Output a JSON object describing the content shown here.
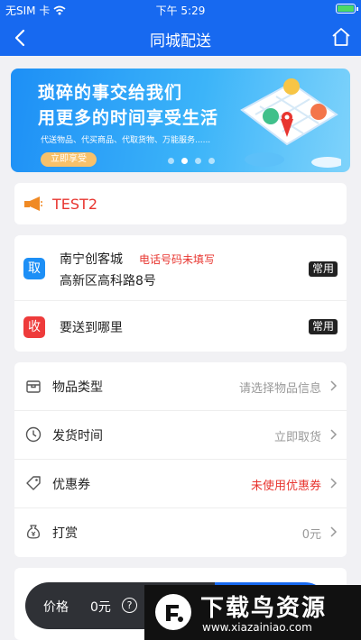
{
  "statusbar": {
    "carrier": "无SIM 卡",
    "time": "下午 5:29"
  },
  "navbar": {
    "title": "同城配送"
  },
  "banner": {
    "line1": "琐碎的事交给我们",
    "line2": "用更多的时间享受生活",
    "sub": "代送物品、代买商品、代取货物、万能服务......",
    "cta": "立即享受",
    "slide_count": 4,
    "active_slide": 2
  },
  "notice": {
    "text": "TEST2"
  },
  "pickup": {
    "tag": "取",
    "name": "南宁创客城",
    "warning": "电话号码未填写",
    "street": "高新区高科路8号",
    "badge": "常用"
  },
  "dropoff": {
    "tag": "收",
    "placeholder": "要送到哪里",
    "badge": "常用"
  },
  "form": {
    "rows": [
      {
        "label": "物品类型",
        "value": "请选择物品信息",
        "icon": "package-icon"
      },
      {
        "label": "发货时间",
        "value": "立即取货",
        "icon": "clock-icon"
      },
      {
        "label": "优惠券",
        "value": "未使用优惠券",
        "icon": "tag-icon",
        "highlight": true
      },
      {
        "label": "打赏",
        "value": "0元",
        "icon": "money-bag-icon"
      }
    ]
  },
  "pricebar": {
    "label": "价格",
    "value": "0元",
    "help": "?"
  },
  "watermark": {
    "title": "下载鸟资源",
    "url": "www.xiazainiao.com"
  },
  "colors": {
    "primary": "#1769f0",
    "danger": "#e8352f",
    "dark": "#2f3136"
  }
}
